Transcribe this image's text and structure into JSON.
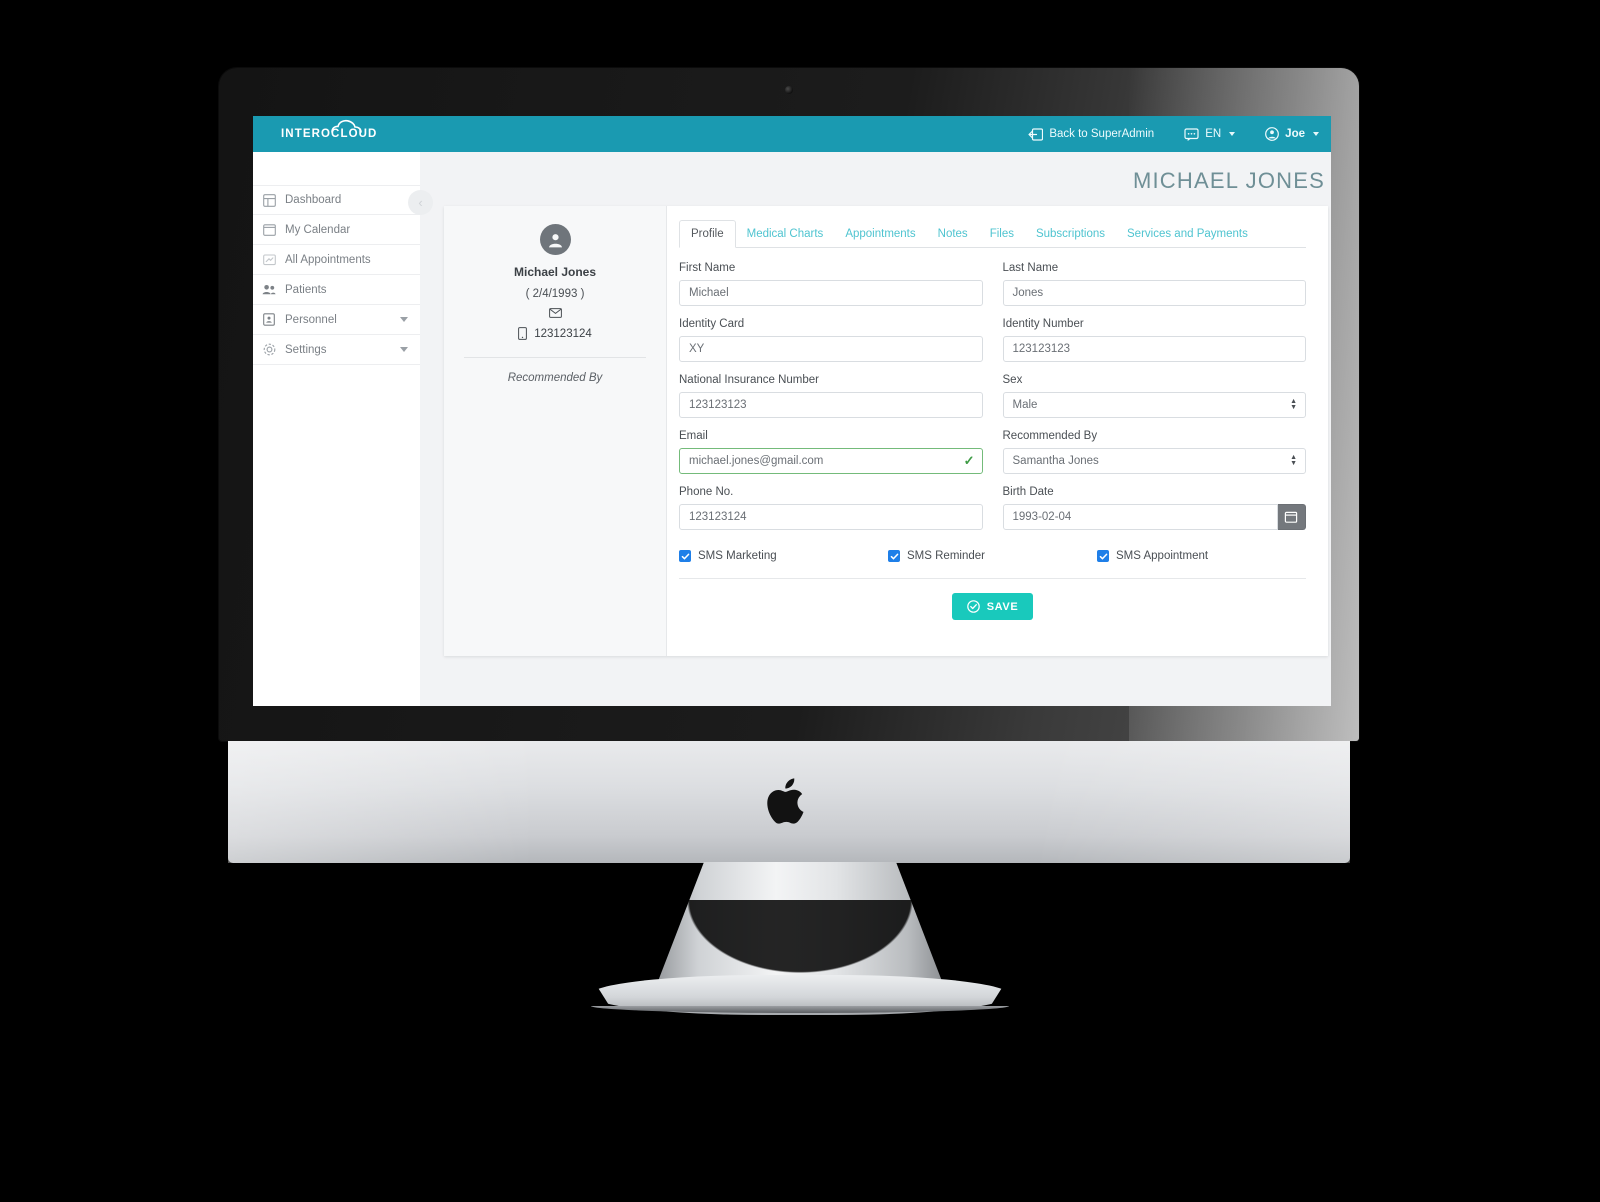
{
  "brand": {
    "name_part1": "INTERO",
    "name_part2": "CLOUD",
    "logo_icon": "cloud-icon"
  },
  "topbar": {
    "back_link": {
      "label": "Back to SuperAdmin",
      "icon": "logout-arrow-icon"
    },
    "language": {
      "label": "EN",
      "icon": "translate-icon"
    },
    "user": {
      "label": "Joe",
      "icon": "user-circle-icon"
    },
    "bg_color": "#1a9ab1"
  },
  "sidebar": {
    "items": [
      {
        "label": "Dashboard",
        "icon": "dashboard-icon",
        "has_chevron": false
      },
      {
        "label": "My Calendar",
        "icon": "calendar-icon",
        "has_chevron": false
      },
      {
        "label": "All Appointments",
        "icon": "appointments-icon",
        "has_chevron": false
      },
      {
        "label": "Patients",
        "icon": "people-icon",
        "has_chevron": false
      },
      {
        "label": "Personnel",
        "icon": "id-badge-icon",
        "has_chevron": true
      },
      {
        "label": "Settings",
        "icon": "gear-icon",
        "has_chevron": true
      }
    ]
  },
  "content": {
    "collapse_icon": "chevron-left-icon",
    "page_title": "MICHAEL JONES"
  },
  "patient_panel": {
    "avatar_icon": "user-avatar-icon",
    "name": "Michael Jones",
    "birth_display": "( 2/4/1993 )",
    "email_icon": "envelope-icon",
    "phone_icon": "mobile-icon",
    "phone": "123123124",
    "recommended_by_label": "Recommended By"
  },
  "tabs": [
    {
      "label": "Profile",
      "active": true
    },
    {
      "label": "Medical Charts",
      "active": false
    },
    {
      "label": "Appointments",
      "active": false
    },
    {
      "label": "Notes",
      "active": false
    },
    {
      "label": "Files",
      "active": false
    },
    {
      "label": "Subscriptions",
      "active": false
    },
    {
      "label": "Services and Payments",
      "active": false
    }
  ],
  "form": {
    "first_name": {
      "label": "First Name",
      "value": "Michael"
    },
    "last_name": {
      "label": "Last Name",
      "value": "Jones"
    },
    "identity_card": {
      "label": "Identity Card",
      "value": "XY"
    },
    "identity_number": {
      "label": "Identity Number",
      "value": "123123123"
    },
    "national_insurance_number": {
      "label": "National Insurance Number",
      "value": "123123123"
    },
    "sex": {
      "label": "Sex",
      "value": "Male"
    },
    "email": {
      "label": "Email",
      "value": "michael.jones@gmail.com",
      "valid": true,
      "valid_icon": "check-icon"
    },
    "recommended_by": {
      "label": "Recommended By",
      "value": "Samantha Jones"
    },
    "phone_no": {
      "label": "Phone No.",
      "value": "123123124"
    },
    "birth_date": {
      "label": "Birth Date",
      "value": "1993-02-04",
      "button_icon": "calendar-icon"
    },
    "checkboxes": [
      {
        "label": "SMS Marketing",
        "checked": true
      },
      {
        "label": "SMS Reminder",
        "checked": true
      },
      {
        "label": "SMS Appointment",
        "checked": true
      }
    ],
    "save_button": {
      "label": "SAVE",
      "icon": "check-circle-icon",
      "color": "#19c9bc"
    }
  }
}
